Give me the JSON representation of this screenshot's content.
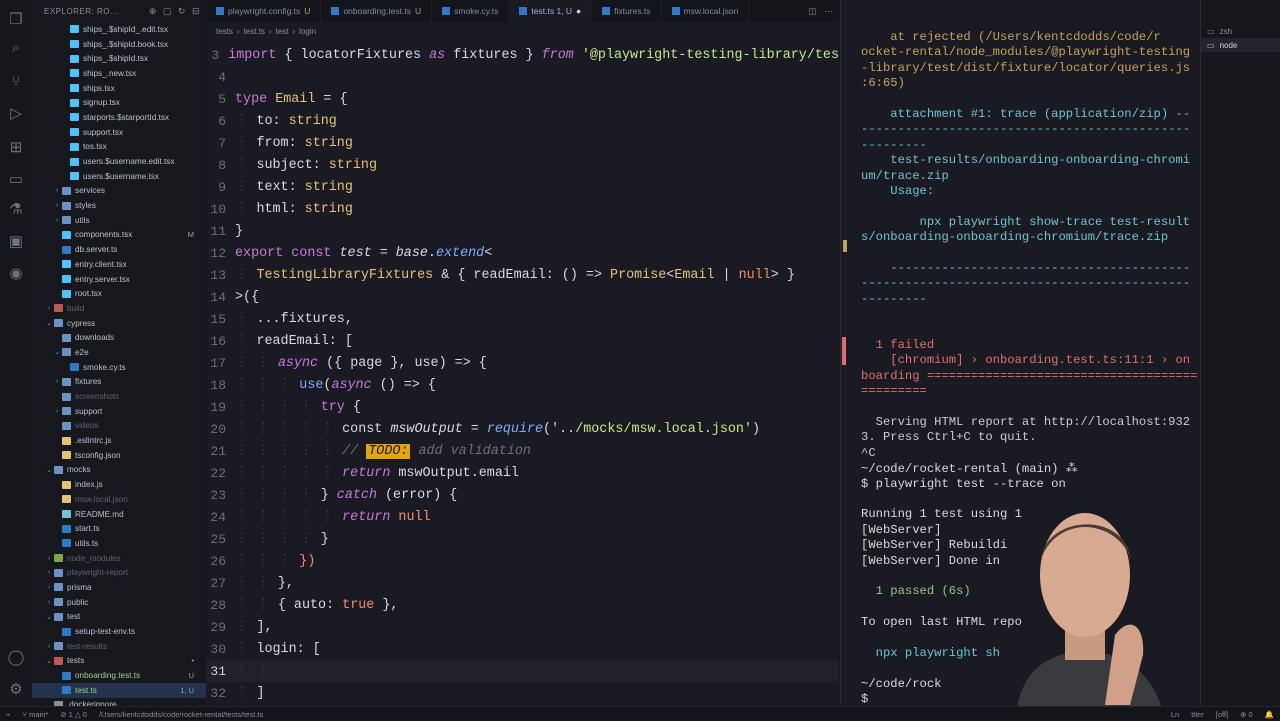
{
  "explorer": {
    "title": "EXPLORER: RO...",
    "rows": [
      {
        "label": "ships_.$shipId_.edit.tsx",
        "type": "tsx",
        "depth": 3
      },
      {
        "label": "ships_.$shipId.book.tsx",
        "type": "tsx",
        "depth": 3
      },
      {
        "label": "ships_.$shipId.tsx",
        "type": "tsx",
        "depth": 3
      },
      {
        "label": "ships_.new.tsx",
        "type": "tsx",
        "depth": 3
      },
      {
        "label": "ships.tsx",
        "type": "tsx",
        "depth": 3
      },
      {
        "label": "signup.tsx",
        "type": "tsx",
        "depth": 3
      },
      {
        "label": "starports.$starportId.tsx",
        "type": "tsx",
        "depth": 3
      },
      {
        "label": "support.tsx",
        "type": "tsx",
        "depth": 3
      },
      {
        "label": "tos.tsx",
        "type": "tsx",
        "depth": 3
      },
      {
        "label": "users.$username.edit.tsx",
        "type": "tsx",
        "depth": 3
      },
      {
        "label": "users.$username.tsx",
        "type": "tsx",
        "depth": 3
      },
      {
        "label": "services",
        "type": "folder",
        "depth": 2,
        "chev": "›"
      },
      {
        "label": "styles",
        "type": "folder",
        "depth": 2,
        "chev": "›"
      },
      {
        "label": "utils",
        "type": "folder",
        "depth": 2,
        "chev": "›"
      },
      {
        "label": "components.tsx",
        "type": "tsx",
        "depth": 2,
        "badge": "M"
      },
      {
        "label": "db.server.ts",
        "type": "ts",
        "depth": 2
      },
      {
        "label": "entry.client.tsx",
        "type": "tsx",
        "depth": 2
      },
      {
        "label": "entry.server.tsx",
        "type": "tsx",
        "depth": 2
      },
      {
        "label": "root.tsx",
        "type": "tsx",
        "depth": 2
      },
      {
        "label": "build",
        "type": "folder-red",
        "depth": 1,
        "chev": "›",
        "dim": true
      },
      {
        "label": "cypress",
        "type": "folder",
        "depth": 1,
        "chev": "⌄"
      },
      {
        "label": "downloads",
        "type": "folder",
        "depth": 2,
        "chev": ""
      },
      {
        "label": "e2e",
        "type": "folder",
        "depth": 2,
        "chev": "⌄"
      },
      {
        "label": "smoke.cy.ts",
        "type": "ts",
        "depth": 3
      },
      {
        "label": "fixtures",
        "type": "folder",
        "depth": 2,
        "chev": "›"
      },
      {
        "label": "screenshots",
        "type": "folder",
        "depth": 2,
        "chev": "",
        "dim": true
      },
      {
        "label": "support",
        "type": "folder",
        "depth": 2,
        "chev": "›"
      },
      {
        "label": "videos",
        "type": "folder",
        "depth": 2,
        "chev": "",
        "dim": true
      },
      {
        "label": ".eslintrc.js",
        "type": "js",
        "depth": 2
      },
      {
        "label": "tsconfig.json",
        "type": "json",
        "depth": 2
      },
      {
        "label": "mocks",
        "type": "folder",
        "depth": 1,
        "chev": "⌄"
      },
      {
        "label": "index.js",
        "type": "js",
        "depth": 2
      },
      {
        "label": "msw.local.json",
        "type": "json",
        "depth": 2,
        "dim": true
      },
      {
        "label": "README.md",
        "type": "md",
        "depth": 2
      },
      {
        "label": "start.ts",
        "type": "ts",
        "depth": 2
      },
      {
        "label": "utils.ts",
        "type": "ts",
        "depth": 2
      },
      {
        "label": "node_modules",
        "type": "folder-green",
        "depth": 1,
        "chev": "›",
        "dim": true
      },
      {
        "label": "playwright-report",
        "type": "folder",
        "depth": 1,
        "chev": "›",
        "dim": true
      },
      {
        "label": "prisma",
        "type": "folder",
        "depth": 1,
        "chev": "›"
      },
      {
        "label": "public",
        "type": "folder",
        "depth": 1,
        "chev": "›"
      },
      {
        "label": "test",
        "type": "folder",
        "depth": 1,
        "chev": "⌄"
      },
      {
        "label": "setup-test-env.ts",
        "type": "ts",
        "depth": 2
      },
      {
        "label": "test-results",
        "type": "folder",
        "depth": 1,
        "chev": "›",
        "dim": true
      },
      {
        "label": "tests",
        "type": "folder-red",
        "depth": 1,
        "chev": "⌄",
        "badge": "•"
      },
      {
        "label": "onboarding.test.ts",
        "type": "ts",
        "depth": 2,
        "badge": "U"
      },
      {
        "label": "test.ts",
        "type": "ts",
        "depth": 2,
        "badge": "1, U",
        "selected": true
      },
      {
        "label": ".dockerignore",
        "type": "file",
        "depth": 1
      }
    ]
  },
  "tabs": [
    {
      "label": "playwright.config.ts",
      "mod": "U"
    },
    {
      "label": "onboarding.test.ts",
      "mod": "U"
    },
    {
      "label": "smoke.cy.ts",
      "mod": ""
    },
    {
      "label": "test.ts 1, U",
      "mod": "●",
      "active": true
    },
    {
      "label": "fixtures.ts",
      "mod": ""
    },
    {
      "label": "msw.local.json",
      "mod": ""
    }
  ],
  "breadcrumb": [
    "tests",
    "test.ts",
    "test",
    "login"
  ],
  "code_lines": [
    {
      "n": "3",
      "html": "<span class='k'>import</span> <span class='p'>{ locatorFixtures </span><span class='k it'>as</span><span class='p'> fixtures } </span><span class='k it'>from</span> <span class='s'>'@playwright-testing-library/tes</span>"
    },
    {
      "n": "4",
      "html": ""
    },
    {
      "n": "5",
      "html": "<span class='k'>type</span> <span class='t'>Email</span><span class='p'> = {</span>"
    },
    {
      "n": "6",
      "html": "<span class='indent'>⋮ </span><span class='p'>to: </span><span class='t'>string</span>"
    },
    {
      "n": "7",
      "html": "<span class='indent'>⋮ </span><span class='p'>from: </span><span class='t'>string</span>"
    },
    {
      "n": "8",
      "html": "<span class='indent'>⋮ </span><span class='p'>subject: </span><span class='t'>string</span>"
    },
    {
      "n": "9",
      "html": "<span class='indent'>⋮ </span><span class='p'>text: </span><span class='t'>string</span>"
    },
    {
      "n": "10",
      "html": "<span class='indent'>⋮ </span><span class='p'>html: </span><span class='t'>string</span>"
    },
    {
      "n": "11",
      "html": "<span class='p'>}</span>"
    },
    {
      "n": "12",
      "html": "<span class='k'>export</span> <span class='k'>const</span> <span class='p it'>test</span><span class='p'> = </span><span class='p it'>base</span><span class='p'>.</span><span class='f it'>extend</span><span class='p'>&lt;</span>"
    },
    {
      "n": "13",
      "html": "<span class='indent'>⋮ </span><span class='t'>TestingLibraryFixtures</span><span class='p'> &amp; { readEmail: () =&gt; </span><span class='t'>Promise</span><span class='p'>&lt;</span><span class='t'>Email</span><span class='p'> | </span><span class='n'>null</span><span class='p'>&gt; }</span>"
    },
    {
      "n": "14",
      "html": "<span class='p'>&gt;({</span>"
    },
    {
      "n": "15",
      "html": "<span class='indent'>⋮ </span><span class='p'>...fixtures,</span>"
    },
    {
      "n": "16",
      "html": "<span class='indent'>⋮ </span><span class='p'>readEmail: [</span>"
    },
    {
      "n": "17",
      "html": "<span class='indent'>⋮ ⋮ </span><span class='k it'>async</span><span class='p'> ({ page }, use) =&gt; {</span>"
    },
    {
      "n": "18",
      "html": "<span class='indent'>⋮ ⋮ ⋮ </span><span class='f'>use</span><span class='p'>(</span><span class='k it'>async</span><span class='p'> () =&gt; {</span>"
    },
    {
      "n": "19",
      "html": "<span class='indent'>⋮ ⋮ ⋮ ⋮ </span><span class='k'>try</span><span class='p'> {</span>"
    },
    {
      "n": "20",
      "html": "<span class='indent'>⋮ ⋮ ⋮ ⋮ ⋮ </span><span class='p'>const </span><span class='p it'>mswOutput</span><span class='p'> = </span><span class='f it'>require</span><span class='p'>(</span><span class='s'>'../mocks/msw.local.json'</span><span class='p'>)</span>"
    },
    {
      "n": "21",
      "html": "<span class='indent'>⋮ ⋮ ⋮ ⋮ ⋮ </span><span class='cm'>// </span><span class='todo'>TODO:</span><span class='cm'> add validation</span>"
    },
    {
      "n": "22",
      "html": "<span class='indent'>⋮ ⋮ ⋮ ⋮ ⋮ </span><span class='k it'>return</span><span class='p'> mswOutput.email</span>"
    },
    {
      "n": "23",
      "html": "<span class='indent'>⋮ ⋮ ⋮ ⋮ </span><span class='p'>} </span><span class='k it'>catch</span><span class='p'> (error) {</span>"
    },
    {
      "n": "24",
      "html": "<span class='indent'>⋮ ⋮ ⋮ ⋮ ⋮ </span><span class='k it'>return</span><span class='p'> </span><span class='n'>null</span>"
    },
    {
      "n": "25",
      "html": "<span class='indent'>⋮ ⋮ ⋮ ⋮ </span><span class='p'>}</span>"
    },
    {
      "n": "26",
      "html": "<span class='indent'>⋮ ⋮ ⋮ </span><span class='n'>})</span>"
    },
    {
      "n": "27",
      "html": "<span class='indent'>⋮ ⋮ </span><span class='p'>},</span>"
    },
    {
      "n": "28",
      "html": "<span class='indent'>⋮ ⋮ </span><span class='p'>{ auto: </span><span class='n'>true</span><span class='p'> },</span>"
    },
    {
      "n": "29",
      "html": "<span class='indent'>⋮ </span><span class='p'>],</span>"
    },
    {
      "n": "30",
      "html": "<span class='indent'>⋮ </span><span class='p'>login: [</span>"
    },
    {
      "n": "31",
      "html": "<span class='indent'>⋮ ⋮ </span>",
      "current": true
    },
    {
      "n": "32",
      "html": "<span class='indent'>⋮ </span><span class='p'>]</span>"
    }
  ],
  "terminal": [
    {
      "text": "    at rejected (/Users/kentcdodds/code/r",
      "color": "#c5a25c"
    },
    {
      "text": "ocket-rental/node_modules/@playwright-testing",
      "color": "#c5a25c"
    },
    {
      "text": "-library/test/dist/fixture/locator/queries.js",
      "color": "#c5a25c"
    },
    {
      "text": ":6:65)",
      "color": "#c5a25c"
    },
    {
      "text": "",
      "color": "#c9ccd4"
    },
    {
      "text": "    attachment #1: trace (application/zip) --",
      "color": "#6fc3d3"
    },
    {
      "text": "---------------------------------------------",
      "color": "#6fc3d3"
    },
    {
      "text": "---------",
      "color": "#6fc3d3"
    },
    {
      "text": "    test-results/onboarding-onboarding-chromi",
      "color": "#6fc3d3"
    },
    {
      "text": "um/trace.zip",
      "color": "#6fc3d3"
    },
    {
      "text": "    Usage:",
      "color": "#6fc3d3"
    },
    {
      "text": "",
      "color": "#c9ccd4"
    },
    {
      "text": "        npx playwright show-trace test-result",
      "color": "#6fc3d3"
    },
    {
      "text": "s/onboarding-onboarding-chromium/trace.zip",
      "color": "#6fc3d3"
    },
    {
      "text": "",
      "color": "#c9ccd4"
    },
    {
      "text": "    -----------------------------------------",
      "color": "#6fc3d3"
    },
    {
      "text": "---------------------------------------------",
      "color": "#6fc3d3"
    },
    {
      "text": "---------",
      "color": "#6fc3d3"
    },
    {
      "text": "",
      "color": "#c9ccd4"
    },
    {
      "text": "",
      "color": "#c9ccd4"
    },
    {
      "text": "  1 failed",
      "color": "#e06c75"
    },
    {
      "text": "    [chromium] › onboarding.test.ts:11:1 › on",
      "color": "#e06c75"
    },
    {
      "text": "boarding =====================================",
      "color": "#e06c75"
    },
    {
      "text": "=========",
      "color": "#e06c75"
    },
    {
      "text": "",
      "color": "#c9ccd4"
    },
    {
      "text": "  Serving HTML report at http://localhost:932",
      "color": "#c9ccd4"
    },
    {
      "text": "3. Press Ctrl+C to quit.",
      "color": "#c9ccd4"
    },
    {
      "text": "^C",
      "color": "#c9ccd4"
    },
    {
      "text": "~/code/rocket-rental (main) ⁂",
      "color": "#d7dae0"
    },
    {
      "text": "$ playwright test --trace on",
      "color": "#d7dae0"
    },
    {
      "text": "",
      "color": "#c9ccd4"
    },
    {
      "text": "Running 1 test using 1",
      "color": "#d7dae0"
    },
    {
      "text": "[WebServer]",
      "color": "#d7dae0"
    },
    {
      "text": "[WebServer] Rebuildi",
      "color": "#d7dae0"
    },
    {
      "text": "[WebServer] Done in",
      "color": "#d7dae0"
    },
    {
      "text": "",
      "color": "#c9ccd4"
    },
    {
      "text": "  1 passed (6s)",
      "color": "#98c379"
    },
    {
      "text": "",
      "color": "#c9ccd4"
    },
    {
      "text": "To open last HTML repo",
      "color": "#d7dae0"
    },
    {
      "text": "",
      "color": "#c9ccd4"
    },
    {
      "text": "  npx playwright sh",
      "color": "#6fc3d3"
    },
    {
      "text": "",
      "color": "#c9ccd4"
    },
    {
      "text": "~/code/rock",
      "color": "#d7dae0"
    },
    {
      "text": "$ ",
      "color": "#d7dae0"
    }
  ],
  "terminal_list": [
    {
      "label": "zsh",
      "selected": false
    },
    {
      "label": "node",
      "selected": true
    }
  ],
  "statusbar": {
    "branch": "main*",
    "sync": "⊘ 1 △ 0",
    "path": "/Users/kentcdodds/code/rocket-rental/tests/test.ts",
    "right": [
      "Ln",
      "ttler",
      "[off]",
      "⊕ 0",
      "🔔"
    ]
  },
  "colors": {
    "accent": "#4d78cc",
    "folder": "#7ba7e0",
    "tsx": "#4fc1ff",
    "ts": "#3178c6",
    "js": "#e5c07b",
    "json": "#e5c07b",
    "md": "#6fc3d3"
  }
}
